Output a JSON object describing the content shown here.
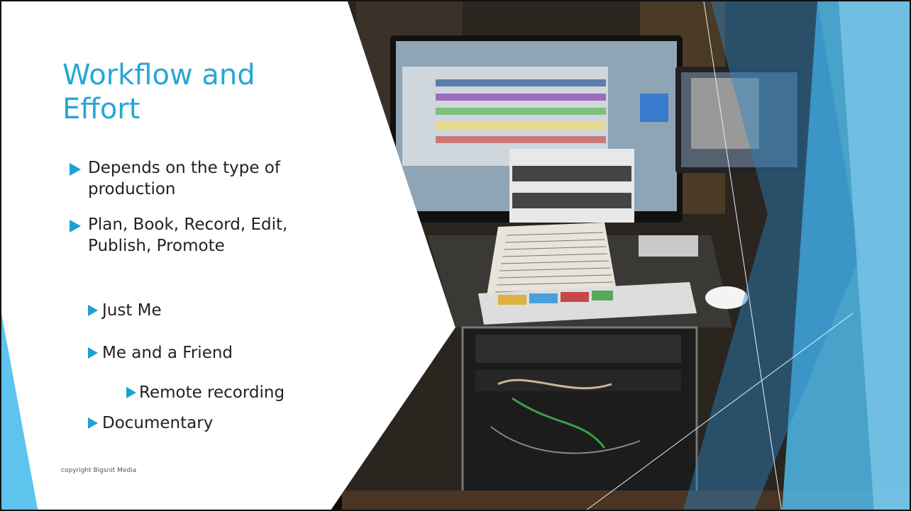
{
  "slide": {
    "title": "Workflow and Effort",
    "bullets": [
      {
        "level": 1,
        "text": "Depends on the type of production"
      },
      {
        "level": 1,
        "text": "Plan, Book, Record, Edit, Publish, Promote"
      },
      {
        "level": 2,
        "text": "Just Me"
      },
      {
        "level": 2,
        "text": "Me and a Friend"
      },
      {
        "level": 3,
        "text": "Remote recording"
      },
      {
        "level": 2,
        "text": "Documentary"
      }
    ],
    "footer": "copyright Bigsnit Media"
  },
  "colors": {
    "title": "#27a6d6",
    "bullet_marker": "#1aa1d8",
    "accent_light": "#5ec4ee",
    "accent_dark": "#1f88c2"
  },
  "photo": {
    "description_icon": "studio-photo"
  }
}
